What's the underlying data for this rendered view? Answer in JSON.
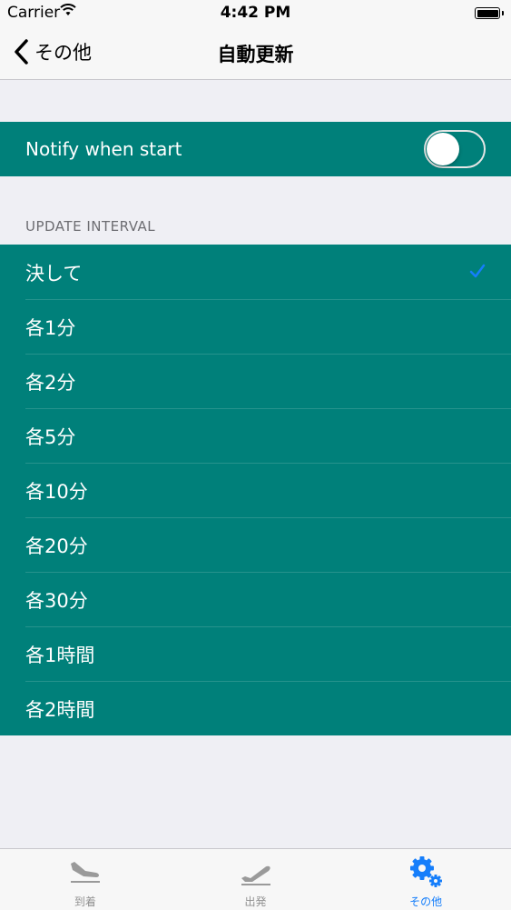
{
  "status_bar": {
    "carrier": "Carrier",
    "time": "4:42 PM"
  },
  "nav": {
    "back_label": "その他",
    "title": "自動更新"
  },
  "notify": {
    "label": "Notify when start",
    "enabled": false
  },
  "interval_section": {
    "header": "UPDATE INTERVAL",
    "selected_index": 0,
    "options": [
      "決して",
      "各1分",
      "各2分",
      "各5分",
      "各10分",
      "各20分",
      "各30分",
      "各1時間",
      "各2時間"
    ]
  },
  "tabs": [
    {
      "label": "到着",
      "icon": "plane-landing-icon",
      "active": false
    },
    {
      "label": "出発",
      "icon": "plane-takeoff-icon",
      "active": false
    },
    {
      "label": "その他",
      "icon": "gears-icon",
      "active": true
    }
  ],
  "colors": {
    "row_background": "#00807a",
    "accent": "#157efb",
    "page_background": "#efeff4"
  }
}
